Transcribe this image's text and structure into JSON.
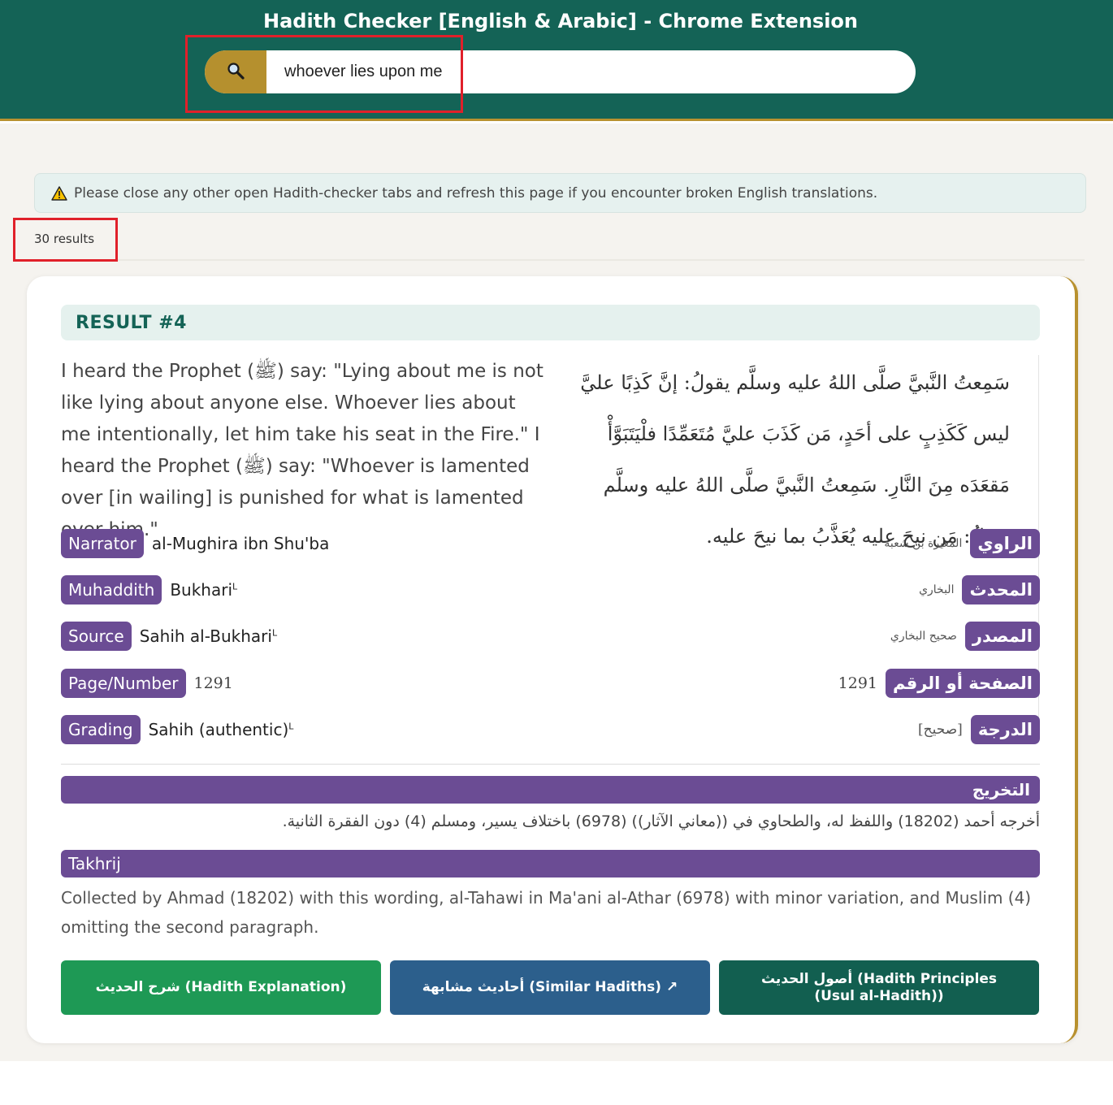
{
  "header": {
    "title": "Hadith Checker [English & Arabic] - Chrome Extension",
    "search_value": "whoever lies upon me"
  },
  "notice": {
    "text": "Please close any other open Hadith-checker tabs and refresh this page if you encounter broken English translations."
  },
  "results": {
    "count_label": "30 results"
  },
  "result": {
    "heading": "RESULT #4",
    "english_text": "I heard the Prophet (ﷺ) say: \"Lying about me is not like lying about anyone else. Whoever lies about me intentionally, let him take his seat in the Fire.\" I heard the Prophet (ﷺ) say: \"Whoever is lamented over [in wailing] is punished for what is lamented over him.\"",
    "arabic_text": "سَمِعتُ النَّبيَّ صلَّى اللهُ عليه وسلَّم يقولُ: إنَّ كَذِبًا عليَّ ليس كَكَذِبٍ على أحَدٍ، مَن كَذَبَ عليَّ مُتَعَمِّدًا فلْيَتَبَوَّأْ مَقعَدَه مِنَ النَّارِ. سَمِعتُ النَّبيَّ صلَّى اللهُ عليه وسلَّم يقولُ: مَن نيحَ عليه يُعَذَّبُ بما نيحَ عليه.",
    "meta": {
      "narrator": {
        "label_en": "Narrator",
        "value_en": "al-Mughira ibn Shu'ba",
        "label_ar": "الراوي",
        "value_ar": "المغيرة بن شعبة"
      },
      "muhaddith": {
        "label_en": "Muhaddith",
        "value_en": "Bukhari",
        "label_ar": "المحدث",
        "value_ar": "البخاري"
      },
      "source": {
        "label_en": "Source",
        "value_en": "Sahih al-Bukhari",
        "label_ar": "المصدر",
        "value_ar": "صحيح البخاري"
      },
      "page": {
        "label_en": "Page/Number",
        "value_en": "1291",
        "label_ar": "الصفحة أو الرقم",
        "value_ar": "1291"
      },
      "grading": {
        "label_en": "Grading",
        "value_en": "Sahih (authentic)",
        "label_ar": "الدرجة",
        "value_ar": "[صحيح]"
      }
    },
    "superscript": "L",
    "takhrij_ar_label": "التخريج",
    "takhrij_ar_text": "أخرجه أحمد (18202) واللفظ له، والطحاوي في ((معاني الآثار)) (6978) باختلاف يسير، ومسلم (4) دون الفقرة الثانية.",
    "takhrij_en_label": "Takhrij",
    "takhrij_en_text": "Collected by Ahmad (18202) with this wording, al-Tahawi in Ma'ani al-Athar (6978) with minor variation, and Muslim (4) omitting the second paragraph."
  },
  "buttons": {
    "explanation": "شرح الحديث (Hadith Explanation)",
    "similar": "أحاديث مشابهة (Similar Hadiths) ↗",
    "principles": "أصول الحديث (Hadith Principles (Usul al-Hadith))"
  },
  "colors": {
    "header_bg": "#146356",
    "accent_gold": "#b8912f",
    "badge_purple": "#6b4c94",
    "btn_green": "#1e9955",
    "btn_blue": "#2c5f8c",
    "btn_teal": "#125f50",
    "highlight_red": "#e0202a"
  },
  "icons": {
    "search": "magnifier-icon",
    "warning": "warning-triangle-icon"
  }
}
